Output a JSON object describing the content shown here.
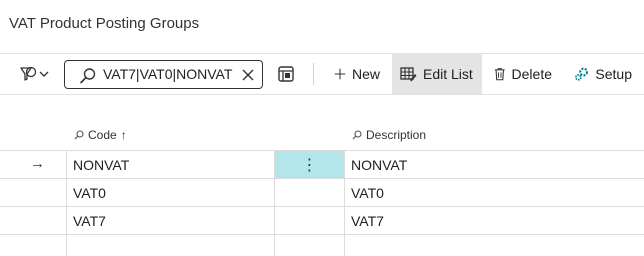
{
  "page": {
    "title": "VAT Product Posting Groups"
  },
  "toolbar": {
    "search_value": "VAT7|VAT0|NONVAT",
    "new_label": "New",
    "edit_list_label": "Edit List",
    "delete_label": "Delete",
    "setup_label": "Setup"
  },
  "table": {
    "columns": {
      "code": "Code",
      "code_sort": "↑",
      "description": "Description"
    },
    "rows": [
      {
        "code": "NONVAT",
        "description": "NONVAT",
        "selected": true
      },
      {
        "code": "VAT0",
        "description": "VAT0"
      },
      {
        "code": "VAT7",
        "description": "VAT7"
      }
    ],
    "current_marker": "→",
    "row_menu": "⋮"
  },
  "colors": {
    "selected_cell": "#b3e6ea",
    "accent": "#00838f"
  }
}
